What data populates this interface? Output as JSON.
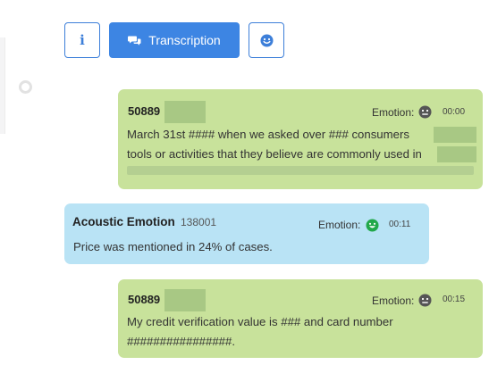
{
  "toolbar": {
    "info_label": "i",
    "transcription_label": "Transcription"
  },
  "messages": [
    {
      "speaker": "50889",
      "emotion_label": "Emotion:",
      "emotion": "neutral-face-icon",
      "time": "00:00",
      "line1": "March 31st #### when we asked over ### consumers",
      "line2": "tools or activities that they believe are commonly used in"
    },
    {
      "speaker": "Acoustic Emotion",
      "speaker_id": "138001",
      "emotion_label": "Emotion:",
      "emotion": "happy-face-icon",
      "time": "00:11",
      "text": "Price was mentioned in 24% of cases."
    },
    {
      "speaker": "50889",
      "emotion_label": "Emotion:",
      "emotion": "neutral-face-icon",
      "time": "00:15",
      "line1": "My credit verification value is ### and card number",
      "line2": "################."
    }
  ],
  "colors": {
    "accent": "#3d85e3",
    "agent_bubble": "#c8e29b",
    "system_bubble": "#b9e3f5",
    "happy": "#22a84a",
    "neutral": "#555555"
  }
}
